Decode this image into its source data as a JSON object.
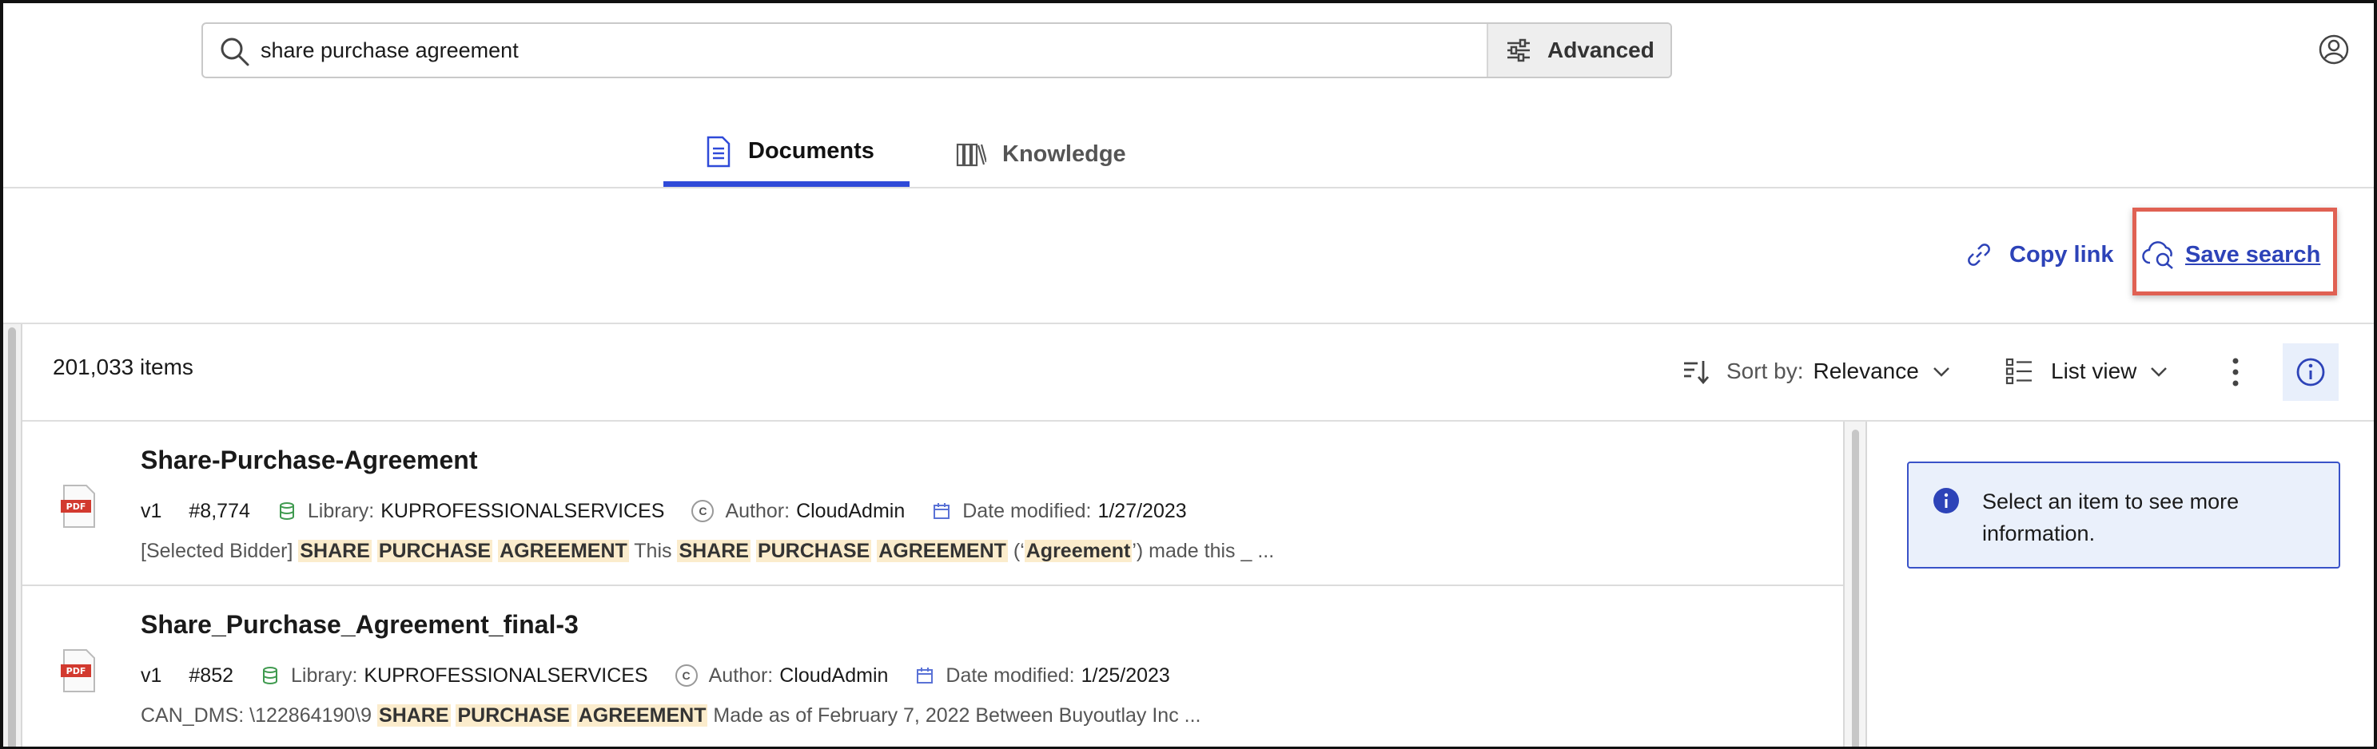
{
  "search": {
    "query": "share purchase agreement",
    "advanced_label": "Advanced"
  },
  "tabs": [
    {
      "label": "Documents",
      "active": true
    },
    {
      "label": "Knowledge",
      "active": false
    }
  ],
  "actions": {
    "copy_link": "Copy link",
    "save_search": "Save search"
  },
  "toolbar": {
    "items_count": "201,033 items",
    "sort_label": "Sort by:",
    "sort_value": "Relevance",
    "view_value": "List view"
  },
  "results": [
    {
      "title": "Share-Purchase-Agreement",
      "version": "v1",
      "number": "#8,774",
      "library_label": "Library:",
      "library": "KUPROFESSIONALSERVICES",
      "author_badge": "C",
      "author_label": "Author:",
      "author": "CloudAdmin",
      "date_label": "Date modified:",
      "date": "1/27/2023",
      "snippet": {
        "p1": "[Selected Bidder] ",
        "h1": "SHARE",
        "h2": "PURCHASE",
        "h3": "AGREEMENT",
        "p2": " This ",
        "h4": "SHARE",
        "h5": "PURCHASE",
        "h6": "AGREEMENT",
        "p3": " (‘",
        "h7": "Agreement",
        "p4": "’) made this _ ..."
      }
    },
    {
      "title": "Share_Purchase_Agreement_final-3",
      "version": "v1",
      "number": "#852",
      "library_label": "Library:",
      "library": "KUPROFESSIONALSERVICES",
      "author_badge": "C",
      "author_label": "Author:",
      "author": "CloudAdmin",
      "date_label": "Date modified:",
      "date": "1/25/2023",
      "snippet": {
        "p1": "CAN_DMS: \\122864190\\9 ",
        "h1": "SHARE",
        "h2": "PURCHASE",
        "h3": "AGREEMENT",
        "p2": " Made as of February 7, 2022 Between Buyoutlay Inc ..."
      }
    }
  ],
  "info_panel": {
    "message": "Select an item to see more information."
  },
  "colors": {
    "accent": "#2f4ad8",
    "link": "#2d43b8",
    "highlight": "#fbeccc",
    "annotation_box": "#e06153",
    "info_bg": "#eaf0fb"
  },
  "icons": {
    "search": "search-icon",
    "clear": "close-icon",
    "advanced": "sliders-icon",
    "profile": "user-circle-icon",
    "documents_tab": "document-icon",
    "knowledge_tab": "books-icon",
    "copy_link": "link-icon",
    "save_search": "cloud-search-icon",
    "sort": "sort-icon",
    "view": "list-view-icon",
    "more": "kebab-icon",
    "info": "info-icon",
    "library": "database-icon",
    "date": "calendar-icon",
    "file": "pdf-icon"
  }
}
